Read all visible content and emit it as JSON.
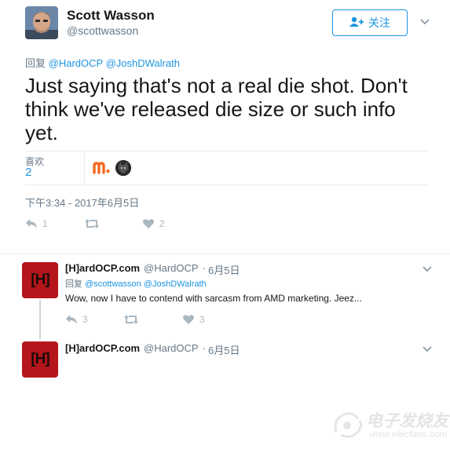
{
  "main_tweet": {
    "display_name": "Scott Wasson",
    "handle": "@scottwasson",
    "follow_label": "关注",
    "reply_prefix": "回复",
    "reply_to": [
      "@HardOCP",
      "@JoshDWalrath"
    ],
    "text": "Just saying that's not a real die shot. Don't think we've released die size or such info yet.",
    "likes_label": "喜欢",
    "likes_count": "2",
    "liker_icons": [
      "m-logo-avatar",
      "cat-avatar"
    ],
    "timestamp": "下午3:34 - 2017年6月5日",
    "actions": {
      "replies": "1",
      "retweets": "",
      "likes": "2"
    }
  },
  "replies": [
    {
      "display_name": "[H]ardOCP.com",
      "handle": "@HardOCP",
      "dot": "·",
      "date": "6月5日",
      "avatar_text": "[H]",
      "reply_prefix": "回复",
      "reply_to": [
        "@scottwasson",
        "@JoshDWalrath"
      ],
      "text": "Wow, now I have to contend with sarcasm from AMD marketing.  Jeez...",
      "actions": {
        "replies": "3",
        "retweets": "",
        "likes": "3"
      }
    },
    {
      "display_name": "[H]ardOCP.com",
      "handle": "@HardOCP",
      "dot": "·",
      "date": "6月5日",
      "avatar_text": "[H]"
    }
  ],
  "watermark": {
    "cn": "电子发烧友",
    "url": "www.elecfans.com"
  },
  "colors": {
    "accent": "#1b95e0",
    "secondary_text": "#657786",
    "action_icon": "#aab8c2",
    "hardocp_red": "#b5161b"
  }
}
